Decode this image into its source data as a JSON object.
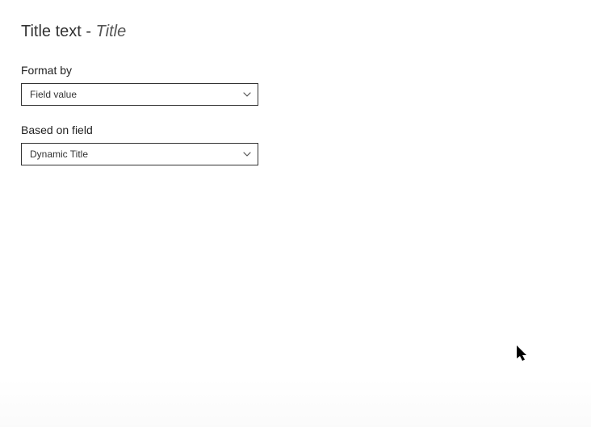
{
  "header": {
    "main": "Title text - ",
    "sub": "Title"
  },
  "fields": {
    "formatBy": {
      "label": "Format by",
      "value": "Field value"
    },
    "basedOnField": {
      "label": "Based on field",
      "value": "Dynamic Title"
    }
  }
}
